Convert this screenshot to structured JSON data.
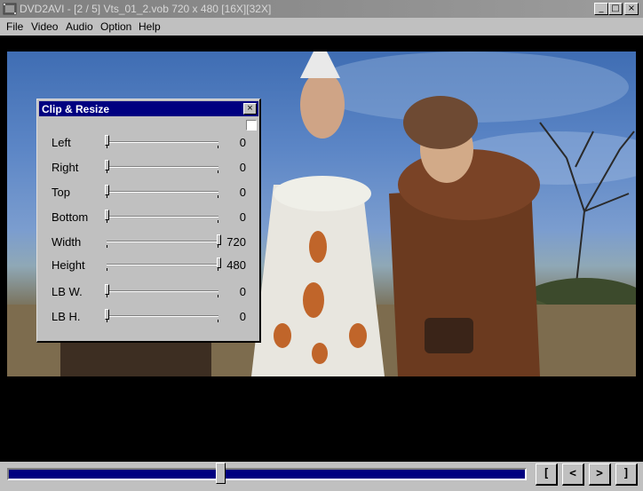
{
  "window": {
    "title": "DVD2AVI - [2 / 5] Vts_01_2.vob 720 x 480 [16X][32X]",
    "minimize_glyph": "_",
    "maximize_glyph": "□",
    "close_glyph": "×",
    "icon": "film-icon"
  },
  "menu": [
    "File",
    "Video",
    "Audio",
    "Option",
    "Help"
  ],
  "dialog": {
    "title": "Clip & Resize",
    "close_glyph": "×",
    "enable_checkbox_checked": false,
    "rows": [
      {
        "label": "Left",
        "value": "0",
        "fraction": 0
      },
      {
        "label": "Right",
        "value": "0",
        "fraction": 0
      },
      {
        "label": "Top",
        "value": "0",
        "fraction": 0
      },
      {
        "label": "Bottom",
        "value": "0",
        "fraction": 0
      },
      {
        "label": "Width",
        "value": "720",
        "fraction": 1
      },
      {
        "label": "Height",
        "value": "480",
        "fraction": 1
      },
      {
        "label": "LB W.",
        "value": "0",
        "fraction": 0
      },
      {
        "label": "LB H.",
        "value": "0",
        "fraction": 0
      }
    ]
  },
  "seek": {
    "position_fraction": 0.41
  },
  "nav_buttons": [
    "[",
    "<",
    ">",
    "]"
  ],
  "colors": {
    "progress": "#000080",
    "dialog_title": "#000080"
  }
}
